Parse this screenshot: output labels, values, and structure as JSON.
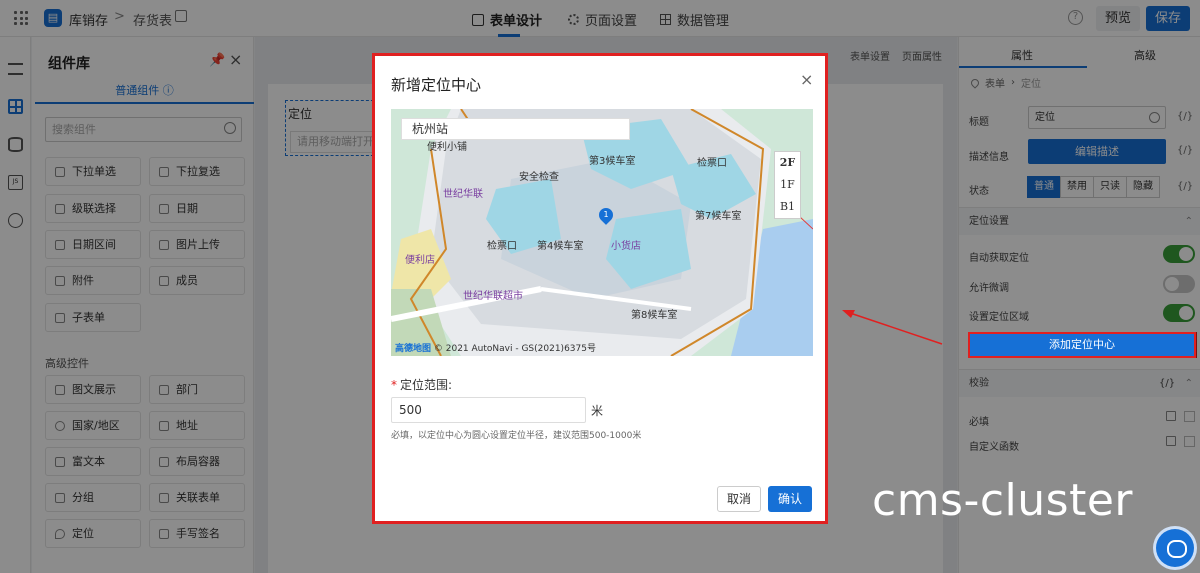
{
  "topbar": {
    "logo_glyph": "▤",
    "app_name": "库销存",
    "breadcrumb_sep": ">",
    "page_name": "存货表",
    "tabs": [
      {
        "icon": "form-design-icon",
        "label": "表单设计",
        "active": true
      },
      {
        "icon": "gear-icon",
        "label": "页面设置",
        "active": false
      },
      {
        "icon": "grid-icon",
        "label": "数据管理",
        "active": false
      }
    ],
    "help_glyph": "?",
    "preview_label": "预览",
    "save_label": "保存"
  },
  "components": {
    "title": "组件库",
    "tab_label": "普通组件",
    "search_placeholder": "搜索组件",
    "basic": [
      "下拉单选",
      "下拉复选",
      "级联选择",
      "日期",
      "日期区间",
      "图片上传",
      "附件",
      "成员",
      "子表单"
    ],
    "advanced_title": "高级控件",
    "advanced": [
      "图文展示",
      "部门",
      "国家/地区",
      "地址",
      "富文本",
      "布局容器",
      "分组",
      "关联表单",
      "定位",
      "手写签名"
    ]
  },
  "canvas": {
    "toolbar": [
      "表单设置",
      "页面属性"
    ],
    "field_label": "定位",
    "field_placeholder": "请用移动端打开"
  },
  "properties": {
    "tabs": [
      "属性",
      "高级"
    ],
    "breadcrumb": [
      "表单",
      "定位"
    ],
    "title_label": "标题",
    "title_value": "定位",
    "desc_label": "描述信息",
    "desc_button": "编辑描述",
    "state_label": "状态",
    "states": [
      "普通",
      "禁用",
      "只读",
      "隐藏"
    ],
    "active_state": "普通",
    "expr_glyph": "{/}",
    "location_section": "定位设置",
    "auto_locate_label": "自动获取定位",
    "auto_locate": true,
    "allow_adjust_label": "允许微调",
    "allow_adjust": false,
    "set_area_label": "设置定位区域",
    "set_area": true,
    "add_center_button": "添加定位中心",
    "validation_section": "校验",
    "required_label": "必填",
    "custom_func_label": "自定义函数"
  },
  "modal": {
    "title": "新增定位中心",
    "close_glyph": "×",
    "map": {
      "search_value": "杭州站",
      "floors": [
        "2F",
        "1F",
        "B1"
      ],
      "active_floor": "2F",
      "pois": [
        "便利小铺",
        "安全检查",
        "第3候车室",
        "检票口",
        "世纪华联",
        "第7候车室",
        "检票口",
        "第4候车室",
        "小货店",
        "便利店",
        "世纪华联超市",
        "第8候车室"
      ],
      "attribution_brand": "高德地图",
      "attribution_text": "© 2021 AutoNavi - GS(2021)6375号"
    },
    "range_required_mark": "*",
    "range_label": "定位范围:",
    "range_value": "500",
    "range_unit": "米",
    "range_hint": "必填，以定位中心为圆心设置定位半径，建议范围500-1000米",
    "cancel_label": "取消",
    "ok_label": "确认"
  },
  "watermark": "cms-cluster",
  "colors": {
    "primary": "#1670d6",
    "highlight": "#e02020",
    "toggle_on": "#3a9e3a"
  }
}
